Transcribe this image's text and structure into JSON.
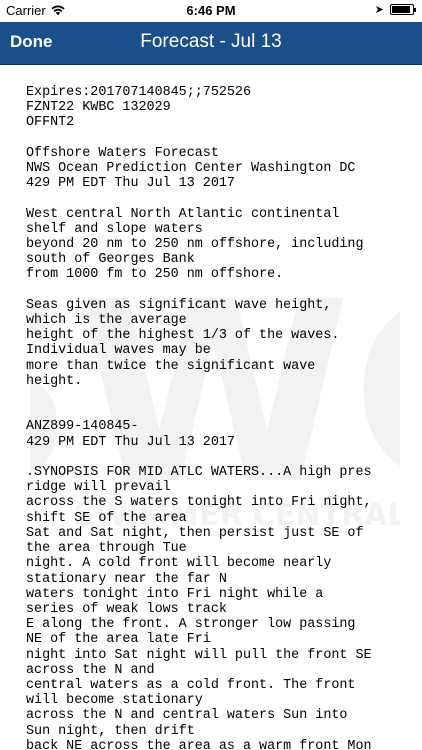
{
  "status_bar": {
    "carrier": "Carrier",
    "time": "6:46 PM",
    "icons": [
      "wifi-icon",
      "location-arrow-icon",
      "battery-icon"
    ]
  },
  "nav": {
    "done_label": "Done",
    "title": "Forecast - Jul 13"
  },
  "watermark": {
    "big_text": "SWC",
    "small_text": "SWIMMER CENTRAL"
  },
  "forecast_text": "Expires:201707140845;;752526\nFZNT22 KWBC 132029\nOFFNT2\n\nOffshore Waters Forecast\nNWS Ocean Prediction Center Washington DC\n429 PM EDT Thu Jul 13 2017\n\nWest central North Atlantic continental\nshelf and slope waters\nbeyond 20 nm to 250 nm offshore, including\nsouth of Georges Bank\nfrom 1000 fm to 250 nm offshore.\n\nSeas given as significant wave height,\nwhich is the average\nheight of the highest 1/3 of the waves.\nIndividual waves may be\nmore than twice the significant wave\nheight.\n\n\nANZ899-140845-\n429 PM EDT Thu Jul 13 2017\n\n.SYNOPSIS FOR MID ATLC WATERS...A high pres\nridge will prevail\nacross the S waters tonight into Fri night,\nshift SE of the area\nSat and Sat night, then persist just SE of\nthe area through Tue\nnight. A cold front will become nearly\nstationary near the far N\nwaters tonight into Fri night while a\nseries of weak lows track\nE along the front. A stronger low passing\nNE of the area late Fri\nnight into Sat night will pull the front SE\nacross the N and\ncentral waters as a cold front. The front\nwill become stationary\nacross the N and central waters Sun into\nSun night, then drift\nback NE across the area as a warm front Mon"
}
